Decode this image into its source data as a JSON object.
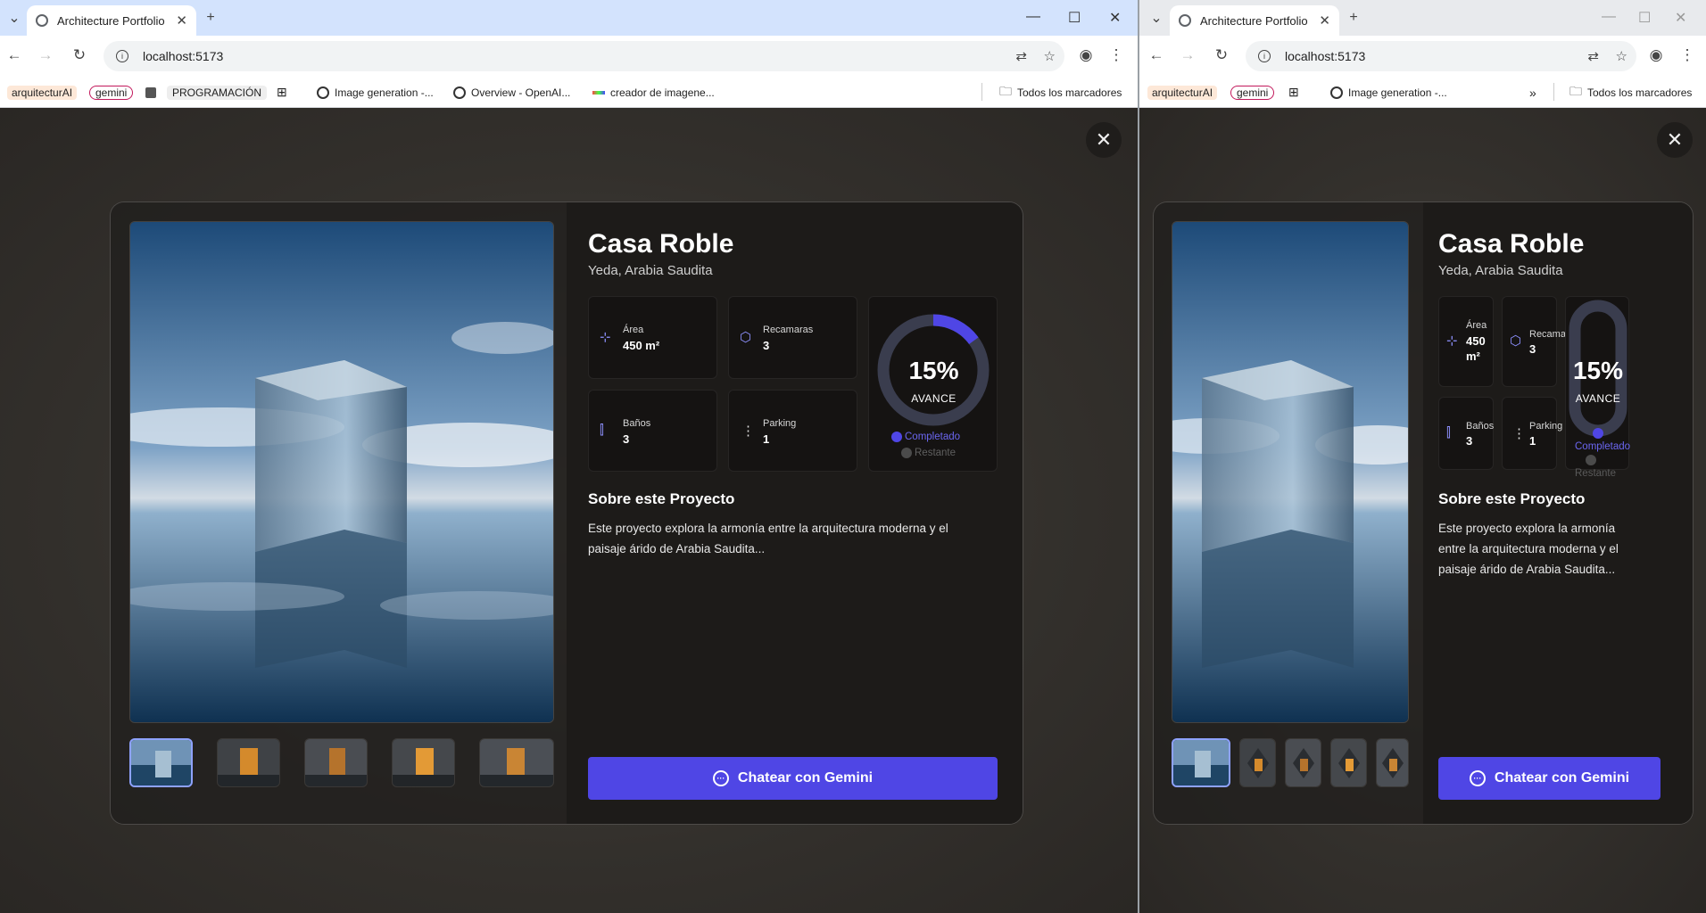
{
  "browser": {
    "tab_title": "Architecture Portfolio",
    "url": "localhost:5173",
    "bookmarks": [
      "arquitecturAI",
      "gemini",
      "PROGRAMACIÓN",
      "Image generation -...",
      "Overview - OpenAI...",
      "creador de imagene..."
    ],
    "bookmarks_narrow": [
      "arquitecturAI",
      "gemini",
      "Image generation -..."
    ],
    "all_bookmarks": "Todos los marcadores"
  },
  "project": {
    "title": "Casa Roble",
    "location": "Yeda, Arabia Saudita",
    "stats": [
      {
        "label": "Área",
        "value": "450 m²",
        "icon": "area-icon"
      },
      {
        "label": "Recamaras",
        "value": "3",
        "icon": "cube-icon"
      },
      {
        "label": "Baños",
        "value": "3",
        "icon": "bath-icon"
      },
      {
        "label": "Parking",
        "value": "1",
        "icon": "dots-icon"
      }
    ],
    "area_value_narrow": [
      "450",
      "m²"
    ],
    "progress": {
      "percent_text": "15%",
      "percent": 15,
      "label": "AVANCE",
      "legend_done": "Completado",
      "legend_rest": "Restante"
    },
    "about_title": "Sobre este Proyecto",
    "about_text": "Este proyecto explora la armonía entre la arquitectura moderna y el paisaje árido de Arabia Saudita...",
    "chat_button": "Chatear con Gemini"
  },
  "colors": {
    "accent": "#4f46e5",
    "ring_track": "#3a3d4e",
    "done": "#4f46e5",
    "rest": "#4b4b4b"
  }
}
